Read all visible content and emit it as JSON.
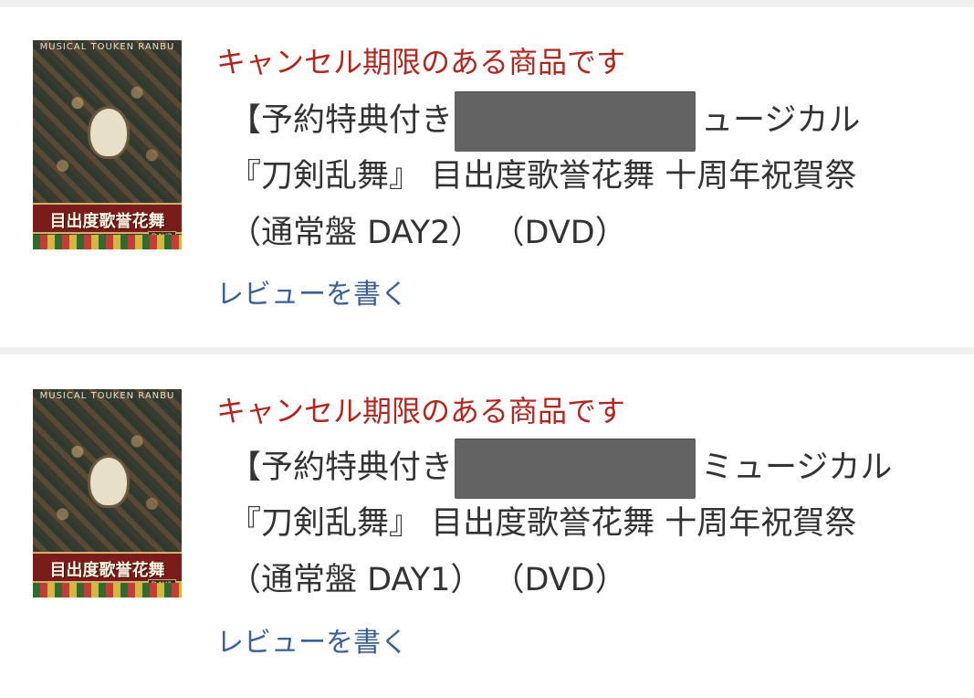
{
  "items": [
    {
      "thumbnail": {
        "alt": "ミュージカル『刀剣乱舞』 目出度歌誉花舞 DVD ジャケット",
        "top_text": "MUSICAL TOUKEN RANBU",
        "cover_title": "目出度歌誉花舞",
        "day_plate": "DAY2"
      },
      "cancel_notice": "キャンセル期限のある商品です",
      "title_lines": [
        "【予約特典付き",
        "ュージカル",
        "『刀剣乱舞』 目出度歌誉花舞 十周年祝賀祭",
        "（通常盤 DAY2） （DVD）"
      ],
      "review_link": "レビューを書く"
    },
    {
      "thumbnail": {
        "alt": "ミュージカル『刀剣乱舞』 目出度歌誉花舞 DVD ジャケット",
        "top_text": "MUSICAL TOUKEN RANBU",
        "cover_title": "目出度歌誉花舞",
        "day_plate": "DAY1"
      },
      "cancel_notice": "キャンセル期限のある商品です",
      "title_lines": [
        "【予約特典付き",
        "ミュージカル",
        "『刀剣乱舞』 目出度歌誉花舞 十周年祝賀祭",
        "（通常盤 DAY1） （DVD）"
      ],
      "review_link": "レビューを書く"
    }
  ],
  "colors": {
    "cancel_notice": "#b3261e",
    "title_text": "#333333",
    "review_link": "#3b5f99",
    "divider": "#f0f0f0",
    "redaction": "#636363"
  }
}
